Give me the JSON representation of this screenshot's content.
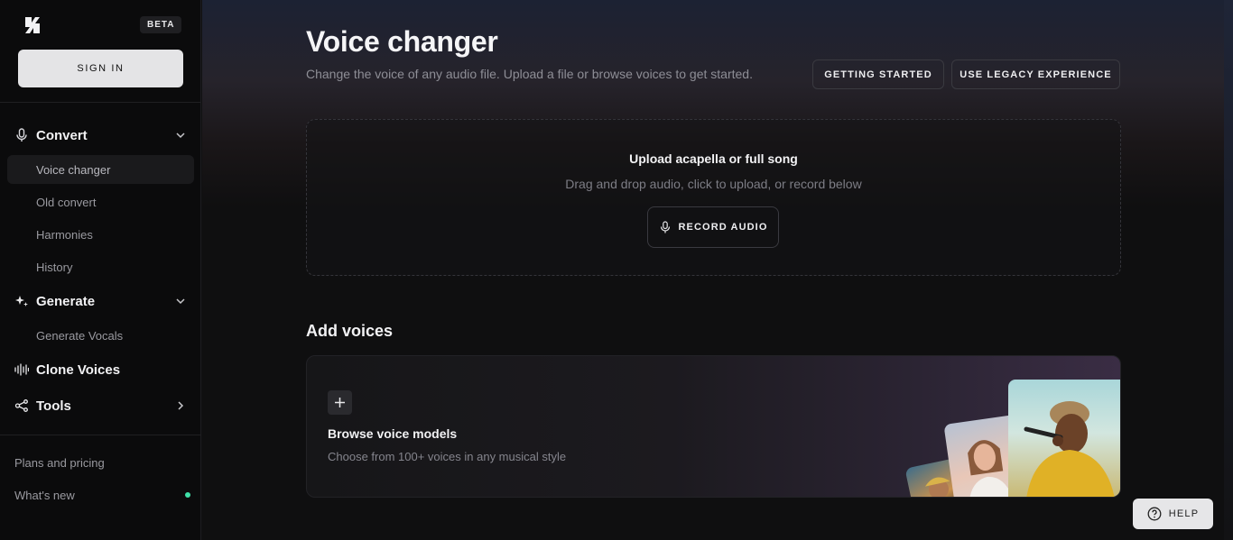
{
  "sidebar": {
    "logo_icon": "brand-logo-icon",
    "beta_badge": "BETA",
    "sign_in": "SIGN IN",
    "sections": {
      "convert": {
        "label": "Convert",
        "icon": "microphone-icon"
      },
      "generate": {
        "label": "Generate",
        "icon": "sparkle-icon"
      },
      "clone": {
        "label": "Clone Voices",
        "icon": "waveform-icon"
      },
      "tools": {
        "label": "Tools",
        "icon": "share-nodes-icon"
      }
    },
    "convert_items": [
      "Voice changer",
      "Old convert",
      "Harmonies",
      "History"
    ],
    "active_item": "Voice changer",
    "generate_items": [
      "Generate Vocals"
    ],
    "footer": {
      "plans": "Plans and pricing",
      "whats_new": "What's new"
    }
  },
  "main": {
    "title": "Voice changer",
    "subtitle": "Change the voice of any audio file. Upload a file or browse voices to get started.",
    "getting_started": "GETTING STARTED",
    "legacy": "USE LEGACY EXPERIENCE",
    "upload": {
      "title": "Upload acapella or full song",
      "subtitle": "Drag and drop audio, click to upload, or record below",
      "record_button": "RECORD AUDIO"
    },
    "add_voices": {
      "heading": "Add voices",
      "card_title": "Browse voice models",
      "card_subtitle": "Choose from 100+ voices in any musical style"
    }
  },
  "help_button": "HELP",
  "colors": {
    "accent_green": "#3fe0a8",
    "sidebar_bg": "#0b0b0c",
    "main_bg": "#0f0f10"
  }
}
